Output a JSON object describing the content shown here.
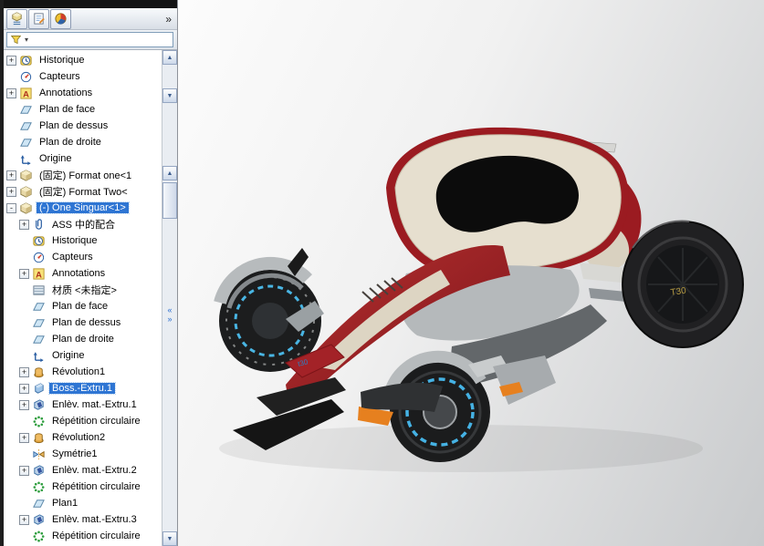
{
  "toolbar": {
    "chevron": "»"
  },
  "filter": {
    "caret": "▾"
  },
  "tree": {
    "items": [
      {
        "label": "Historique",
        "icon": "history",
        "expand": "+",
        "indent": 0,
        "selected": false
      },
      {
        "label": "Capteurs",
        "icon": "sensors",
        "expand": null,
        "indent": 0,
        "selected": false
      },
      {
        "label": "Annotations",
        "icon": "annotations",
        "expand": "+",
        "indent": 0,
        "selected": false
      },
      {
        "label": "Plan de face",
        "icon": "plane",
        "expand": null,
        "indent": 0,
        "selected": false
      },
      {
        "label": "Plan de dessus",
        "icon": "plane",
        "expand": null,
        "indent": 0,
        "selected": false
      },
      {
        "label": "Plan de droite",
        "icon": "plane",
        "expand": null,
        "indent": 0,
        "selected": false
      },
      {
        "label": "Origine",
        "icon": "origin",
        "expand": null,
        "indent": 0,
        "selected": false
      },
      {
        "label": "(固定) Format one<1",
        "icon": "component",
        "expand": "+",
        "indent": 0,
        "selected": false
      },
      {
        "label": "(固定) Format Two<",
        "icon": "component",
        "expand": "+",
        "indent": 0,
        "selected": false
      },
      {
        "label": "(-) One Singuar<1>",
        "icon": "component",
        "expand": "-",
        "indent": 0,
        "selected": true
      },
      {
        "label": "ASS 中的配合",
        "icon": "mates",
        "expand": "+",
        "indent": 1,
        "selected": false
      },
      {
        "label": "Historique",
        "icon": "history",
        "expand": null,
        "indent": 1,
        "selected": false
      },
      {
        "label": "Capteurs",
        "icon": "sensors",
        "expand": null,
        "indent": 1,
        "selected": false
      },
      {
        "label": "Annotations",
        "icon": "annotations",
        "expand": "+",
        "indent": 1,
        "selected": false
      },
      {
        "label": "材质 <未指定>",
        "icon": "material",
        "expand": null,
        "indent": 1,
        "selected": false
      },
      {
        "label": "Plan de face",
        "icon": "plane",
        "expand": null,
        "indent": 1,
        "selected": false
      },
      {
        "label": "Plan de dessus",
        "icon": "plane",
        "expand": null,
        "indent": 1,
        "selected": false
      },
      {
        "label": "Plan de droite",
        "icon": "plane",
        "expand": null,
        "indent": 1,
        "selected": false
      },
      {
        "label": "Origine",
        "icon": "origin",
        "expand": null,
        "indent": 1,
        "selected": false
      },
      {
        "label": "Révolution1",
        "icon": "revolve",
        "expand": "+",
        "indent": 1,
        "selected": false
      },
      {
        "label": "Boss.-Extru.1",
        "icon": "boss-extrude",
        "expand": "+",
        "indent": 1,
        "selected": true
      },
      {
        "label": "Enlèv. mat.-Extru.1",
        "icon": "cut-extrude",
        "expand": "+",
        "indent": 1,
        "selected": false
      },
      {
        "label": "Répétition circulaire",
        "icon": "circular-pattern",
        "expand": null,
        "indent": 1,
        "selected": false
      },
      {
        "label": "Révolution2",
        "icon": "revolve",
        "expand": "+",
        "indent": 1,
        "selected": false
      },
      {
        "label": "Symétrie1",
        "icon": "mirror",
        "expand": null,
        "indent": 1,
        "selected": false
      },
      {
        "label": "Enlèv. mat.-Extru.2",
        "icon": "cut-extrude",
        "expand": "+",
        "indent": 1,
        "selected": false
      },
      {
        "label": "Répétition circulaire",
        "icon": "circular-pattern",
        "expand": null,
        "indent": 1,
        "selected": false
      },
      {
        "label": "Plan1",
        "icon": "plane",
        "expand": null,
        "indent": 1,
        "selected": false
      },
      {
        "label": "Enlèv. mat.-Extru.3",
        "icon": "cut-extrude",
        "expand": "+",
        "indent": 1,
        "selected": false
      },
      {
        "label": "Répétition circulaire",
        "icon": "circular-pattern",
        "expand": null,
        "indent": 1,
        "selected": false
      }
    ]
  },
  "scrollbar": {
    "up": "▲",
    "down": "▼"
  },
  "splitter": {
    "left": "«",
    "right": "»"
  },
  "viewport": {
    "wheel_label": "T30",
    "nose_label": "t30"
  },
  "colors": {
    "selection": "#2e75d3",
    "body_red": "#9b1b21",
    "body_cream": "#e6dfcf",
    "accent_orange": "#e6801f",
    "accent_blue": "#45b2e4"
  }
}
